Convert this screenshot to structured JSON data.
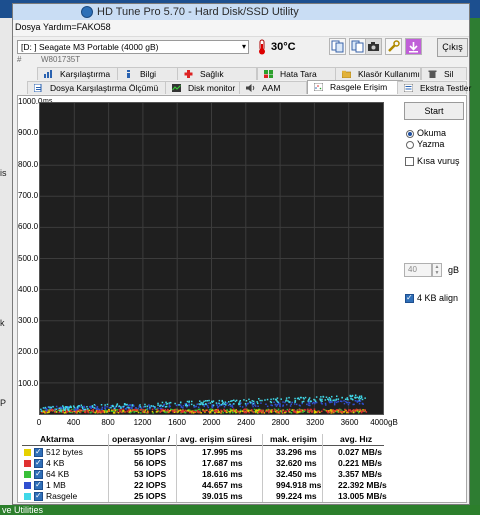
{
  "window": {
    "title": "HD Tune Pro 5.70 - Hard Disk/SSD Utility"
  },
  "menu": {
    "items": [
      "Dosya",
      "Yardım=FAKO58"
    ]
  },
  "toolbar": {
    "drive": "[D: ] Seagate M3 Portable (4000 gB)",
    "serial_hash": "#",
    "serial": "W801735T",
    "temperature": "30°C",
    "exit_label": "Çıkış"
  },
  "tabs_top": [
    "Karşılaştırma",
    "Bilgi",
    "Sağlık",
    "Hata Tara",
    "Klasör Kullanımı",
    "Sil"
  ],
  "tabs_bottom": [
    "Dosya Karşılaştırma Ölçümü",
    "Disk monitor",
    "AAM",
    "Rasgele Erişim",
    "Ekstra Testler"
  ],
  "controls": {
    "start_label": "Start",
    "read_label": "Okuma",
    "write_label": "Yazma",
    "short_stroke_label": "Kısa vuruş",
    "short_stroke_value": "40",
    "short_stroke_unit": "gB",
    "align_label": "4 KB align",
    "mode": "read",
    "short_stroke": false,
    "align_4kb": true
  },
  "chart_data": {
    "type": "scatter",
    "y_unit": "ms",
    "x_unit": "gB",
    "x_range": [
      0,
      4000
    ],
    "y_range": [
      0,
      1000
    ],
    "y_ticks": [
      "1000.0",
      "900.0",
      "800.0",
      "700.0",
      "600.0",
      "500.0",
      "400.0",
      "300.0",
      "200.0",
      "100.0"
    ],
    "x_ticks": [
      "0",
      "400",
      "800",
      "1200",
      "1600",
      "2000",
      "2400",
      "2800",
      "3200",
      "3600",
      "4000gB"
    ],
    "series": [
      {
        "name": "512 bytes",
        "color": "#e6d100"
      },
      {
        "name": "4 KB",
        "color": "#e03030"
      },
      {
        "name": "64 KB",
        "color": "#38c038"
      },
      {
        "name": "1 MB",
        "color": "#2f4fd0"
      },
      {
        "name": "Rasgele",
        "color": "#40d8e8"
      }
    ]
  },
  "table": {
    "headers": [
      "Aktarma",
      "operasyonlar /",
      "avg. erişim süresi",
      "mak. erişim",
      "avg. Hız"
    ],
    "rows": [
      {
        "name": "512 bytes",
        "iops": "55 IOPS",
        "avg": "17.995 ms",
        "max": "33.296 ms",
        "speed": "0.027 MB/s",
        "color": "#e6d100"
      },
      {
        "name": "4 KB",
        "iops": "56 IOPS",
        "avg": "17.687 ms",
        "max": "32.620 ms",
        "speed": "0.221 MB/s",
        "color": "#e03030"
      },
      {
        "name": "64 KB",
        "iops": "53 IOPS",
        "avg": "18.616 ms",
        "max": "32.450 ms",
        "speed": "3.357 MB/s",
        "color": "#38c038"
      },
      {
        "name": "1 MB",
        "iops": "22 IOPS",
        "avg": "44.657 ms",
        "max": "994.918 ms",
        "speed": "22.392 MB/s",
        "color": "#2f4fd0"
      },
      {
        "name": "Rasgele",
        "iops": "25 IOPS",
        "avg": "39.015 ms",
        "max": "99.224 ms",
        "speed": "13.005 MB/s",
        "color": "#40d8e8"
      }
    ]
  },
  "background": {
    "bottom_text": "ve Utilities"
  }
}
